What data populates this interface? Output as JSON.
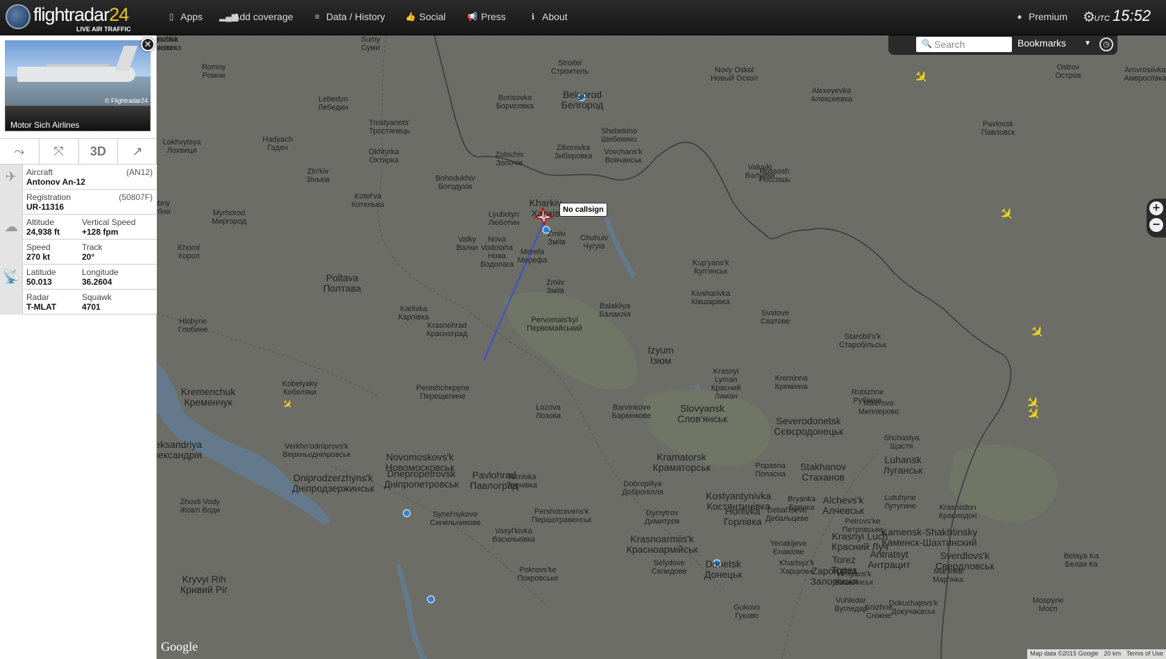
{
  "brand": {
    "name_a": "flightradar",
    "name_b": "24",
    "tagline": "LIVE AIR TRAFFIC"
  },
  "nav": [
    {
      "label": "Apps",
      "icon": "phone-icon"
    },
    {
      "label": "Add coverage",
      "icon": "signal-icon"
    },
    {
      "label": "Data / History",
      "icon": "database-icon"
    },
    {
      "label": "Social",
      "icon": "thumbs-up-icon"
    },
    {
      "label": "Press",
      "icon": "megaphone-icon"
    },
    {
      "label": "About",
      "icon": "info-icon"
    }
  ],
  "premium": "Premium",
  "clock": {
    "zone": "UTC",
    "time": "15:52"
  },
  "search": {
    "placeholder": "Search"
  },
  "bookmarks": "Bookmarks",
  "flight": {
    "photo_credit": "© Flightradar24",
    "airline": "Motor Sich Airlines",
    "tool_3d": "3D",
    "aircraft_label": "Aircraft",
    "aircraft": "Antonov An-12",
    "aircraft_code": "(AN12)",
    "registration_label": "Registration",
    "registration": "UR-11316",
    "registration_code": "(50807F)",
    "altitude_label": "Altitude",
    "altitude": "24,938 ft",
    "vspeed_label": "Vertical Speed",
    "vspeed": "+128 fpm",
    "speed_label": "Speed",
    "speed": "270 kt",
    "track_label": "Track",
    "track": "20°",
    "lat_label": "Latitude",
    "lat": "50.013",
    "lon_label": "Longitude",
    "lon": "36.2604",
    "radar_label": "Radar",
    "radar": "T-MLAT",
    "squawk_label": "Squawk",
    "squawk": "4701"
  },
  "tooltip": "No callsign",
  "google": "Google",
  "attribution": {
    "data": "Map data ©2015 Google",
    "scale": "20 km",
    "terms": "Terms of Use"
  },
  "cities": [
    {
      "name": "Sumy\nСуми",
      "big": false
    },
    {
      "name": "Romny\nРомни",
      "big": false
    },
    {
      "name": "Lebedyn\nЛебедин",
      "big": false
    },
    {
      "name": "Trostyanets'\nТростянець",
      "big": false
    },
    {
      "name": "Borisovka\nБорисовка",
      "big": false
    },
    {
      "name": "Belgorod\nБелгород",
      "big": true
    },
    {
      "name": "Stroitel\nСтроитель",
      "big": false
    },
    {
      "name": "Novy Oskol\nНовый Оскол",
      "big": false
    },
    {
      "name": "Alexeyevka\nАлексеевка",
      "big": false
    },
    {
      "name": "Lokhvytsya\nЛохвиця",
      "big": false
    },
    {
      "name": "Hadyach\nГадяч",
      "big": false
    },
    {
      "name": "Okhtyrka\nОхтирка",
      "big": false
    },
    {
      "name": "Zolochiv\nЗолочів",
      "big": false
    },
    {
      "name": "Shebekino\nШебекино",
      "big": false
    },
    {
      "name": "Ziborovka\nЗиборовка",
      "big": false
    },
    {
      "name": "Vovchans'k\nВовчанськ",
      "big": false
    },
    {
      "name": "Valuyki\nВалуйки",
      "big": false
    },
    {
      "name": "Rossosh\nРоссошь",
      "big": false
    },
    {
      "name": "Pavlovsk\nПавловск",
      "big": false
    },
    {
      "name": "Zin'kiv\nЗіньків",
      "big": false
    },
    {
      "name": "Bohodukhiv\nБогодухів",
      "big": false
    },
    {
      "name": "Kotel'va\nКотельва",
      "big": false
    },
    {
      "name": "Lubny\nЛубни",
      "big": false
    },
    {
      "name": "Myrhorod\nМиргород",
      "big": false
    },
    {
      "name": "Lyubotyn\nЛюботин",
      "big": false
    },
    {
      "name": "Kharkiv\nХарків",
      "big": true
    },
    {
      "name": "Zmiiv\nЗміїв",
      "big": false
    },
    {
      "name": "Chuhuiv\nЧугуїв",
      "big": false
    },
    {
      "name": "Khorol\nХорол",
      "big": false
    },
    {
      "name": "Valky\nВалки",
      "big": false
    },
    {
      "name": "Nova\nVodolaha\nНова\nВодолага",
      "big": false
    },
    {
      "name": "Merefa\nМерефа",
      "big": false
    },
    {
      "name": "Poltava\nПолтава",
      "big": true
    },
    {
      "name": "Zmiiv\nЗміїв",
      "big": false
    },
    {
      "name": "Kup'yans'k\nКуп'янськ",
      "big": false
    },
    {
      "name": "Kivsharivka\nКівшарівка",
      "big": false
    },
    {
      "name": "Svatove\nСватове",
      "big": false
    },
    {
      "name": "Starobil's'k\nСтаробільськ",
      "big": false
    },
    {
      "name": "Karlivka\nКарлівка",
      "big": false
    },
    {
      "name": "Krasnohrad\nКрасноград",
      "big": false
    },
    {
      "name": "Pervomais'kyi\nПервомайський",
      "big": false
    },
    {
      "name": "Balakliya\nБалаклія",
      "big": false
    },
    {
      "name": "Hlobyne\nГлобине",
      "big": false
    },
    {
      "name": "Izyum\nІзюм",
      "big": true
    },
    {
      "name": "Krasnyi\nLyman\nКрасний\nЛиман",
      "big": false
    },
    {
      "name": "Kreminna\nКремінна",
      "big": false
    },
    {
      "name": "Rubizhne\nРубіжне",
      "big": false
    },
    {
      "name": "Kobelyaky\nКобеляки",
      "big": false
    },
    {
      "name": "Pereshchepyne\nПерещепине",
      "big": false
    },
    {
      "name": "Kremenchuk\nКременчук",
      "big": true
    },
    {
      "name": "Lozova\nЛозова",
      "big": false
    },
    {
      "name": "Barvinkove\nБарвінкове",
      "big": false
    },
    {
      "name": "Slovyansk\nСлов'янськ",
      "big": true
    },
    {
      "name": "Severodonetsk\nСєвєродонецьк",
      "big": true
    },
    {
      "name": "Millerovo\nМиллерово",
      "big": false
    },
    {
      "name": "Oleksandriya\nОлександрія",
      "big": true
    },
    {
      "name": "Verkhn'odniprovs'k\nВерхньодніпровськ",
      "big": false
    },
    {
      "name": "Novomoskovs'k\nНовомосковськ",
      "big": true
    },
    {
      "name": "Shchastya\nЩастя",
      "big": false
    },
    {
      "name": "Kramatorsk\nКраматорськ",
      "big": true
    },
    {
      "name": "Popasna\nПопасна",
      "big": false
    },
    {
      "name": "Stakhanov\nСтаханов",
      "big": true
    },
    {
      "name": "Luhansk\nЛуганськ",
      "big": true
    },
    {
      "name": "Dniprodzerzhyns'k\nДніпродзержинськ",
      "big": true
    },
    {
      "name": "Dnepropetrovsk\nДніпропетровськ",
      "big": true
    },
    {
      "name": "Pavlohrad\nПавлоград",
      "big": true
    },
    {
      "name": "Ternivka\nТернівка",
      "big": false
    },
    {
      "name": "Dobropillya\nДобропілля",
      "big": false
    },
    {
      "name": "Kostyantynivka\nКостянтинівка",
      "big": true
    },
    {
      "name": "Bryanka\nБрянка",
      "big": false
    },
    {
      "name": "Alchevs'k\nАлчевськ",
      "big": true
    },
    {
      "name": "Lutuhyne\nЛутугине",
      "big": false
    },
    {
      "name": "Zhovti Vody\nЖовті Води",
      "big": false
    },
    {
      "name": "Synel'nykove\nСинельникове",
      "big": false
    },
    {
      "name": "Pershotravens'k\nПершотравенськ",
      "big": false
    },
    {
      "name": "Dymytrov\nДимитров",
      "big": false
    },
    {
      "name": "Horlivka\nГорлівка",
      "big": true
    },
    {
      "name": "Debal'tseve\nДебальцеве",
      "big": false
    },
    {
      "name": "Krasnodon\nКраснодон",
      "big": false
    },
    {
      "name": "Vasyl'kivka\nВасильківка",
      "big": false
    },
    {
      "name": "Krasnoarmiis'k\nКрасноармійськ",
      "big": true
    },
    {
      "name": "Petrovs'ke\nПетровське",
      "big": false
    },
    {
      "name": "Krasnyi Luch\nКрасний Луч",
      "big": true
    },
    {
      "name": "Kamensk-Shakhtinsky\nКаменск-Шахтинский",
      "big": true
    },
    {
      "name": "Yenakijeve\nЄнакієве",
      "big": false
    },
    {
      "name": "Kryvyi Rih\nКривий Ріг",
      "big": true
    },
    {
      "name": "Pokrovs'ke\nПокровське",
      "big": false
    },
    {
      "name": "Selydove\nСелидове",
      "big": false
    },
    {
      "name": "Donetsk\nДонецьк",
      "big": true
    },
    {
      "name": "Khartsyz'k\nХарцизьк",
      "big": false
    },
    {
      "name": "Torez\nТорез",
      "big": true
    },
    {
      "name": "Antratsyt\nАнтрацит",
      "big": true
    },
    {
      "name": "Sverdlovs'k\nСвердловськ",
      "big": true
    },
    {
      "name": "Belaya Ka\nБелая Ка",
      "big": false
    },
    {
      "name": "Zaporizhia\nЗапоріжжя",
      "big": true
    },
    {
      "name": "Vil'nyans'k\nВільнянськ",
      "big": false
    },
    {
      "name": "Mar'inka\nМар'їнка",
      "big": false
    },
    {
      "name": "Snizhne\nСніжне",
      "big": false
    },
    {
      "name": "Gukovo\nГуково",
      "big": false
    },
    {
      "name": "Vuhledar\nВугледар",
      "big": false
    },
    {
      "name": "Dokuchajevs'k\nДокучаєвськ",
      "big": false
    },
    {
      "name": "Mospyne\nМосп",
      "big": false
    },
    {
      "name": "Amvrosiivka\nАмвросіївка",
      "big": false
    },
    {
      "name": "Ostrov\nОстров",
      "big": false
    },
    {
      "name": "Ostrogozhsk\nОстрогожск",
      "big": false
    },
    {
      "name": "Buturlinovka\nБутурлиновка",
      "big": false
    }
  ]
}
